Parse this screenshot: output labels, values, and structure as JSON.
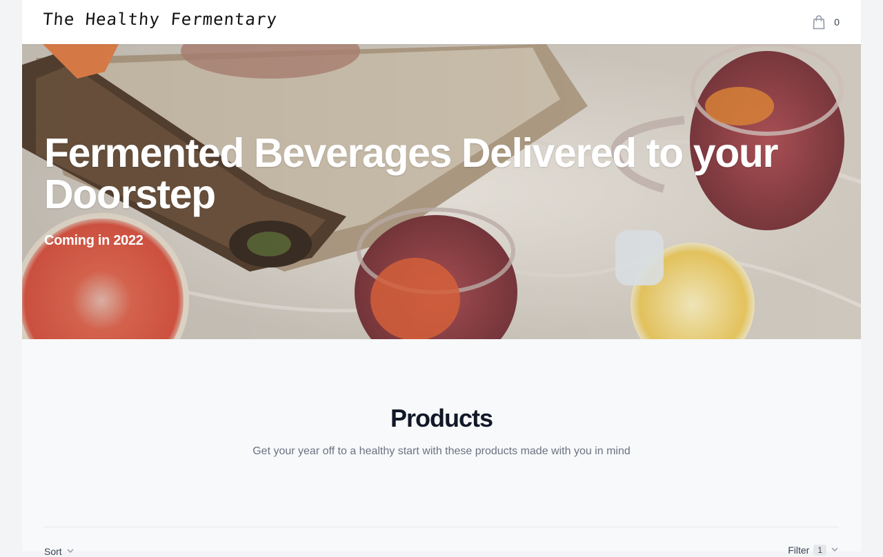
{
  "header": {
    "logo_text": "The Healthy Fermentary",
    "cart_count": "0",
    "cart_icon": "shopping-bag-icon"
  },
  "hero": {
    "title": "Fermented Beverages Delivered to your Doorstep",
    "subtitle": "Coming in 2022"
  },
  "products": {
    "title": "Products",
    "description": "Get your year off to a healthy start with these products made with you in mind"
  },
  "toolbar": {
    "sort_label": "Sort",
    "filter_label": "Filter",
    "filter_count": "1",
    "chevron_icon": "chevron-down-icon"
  }
}
